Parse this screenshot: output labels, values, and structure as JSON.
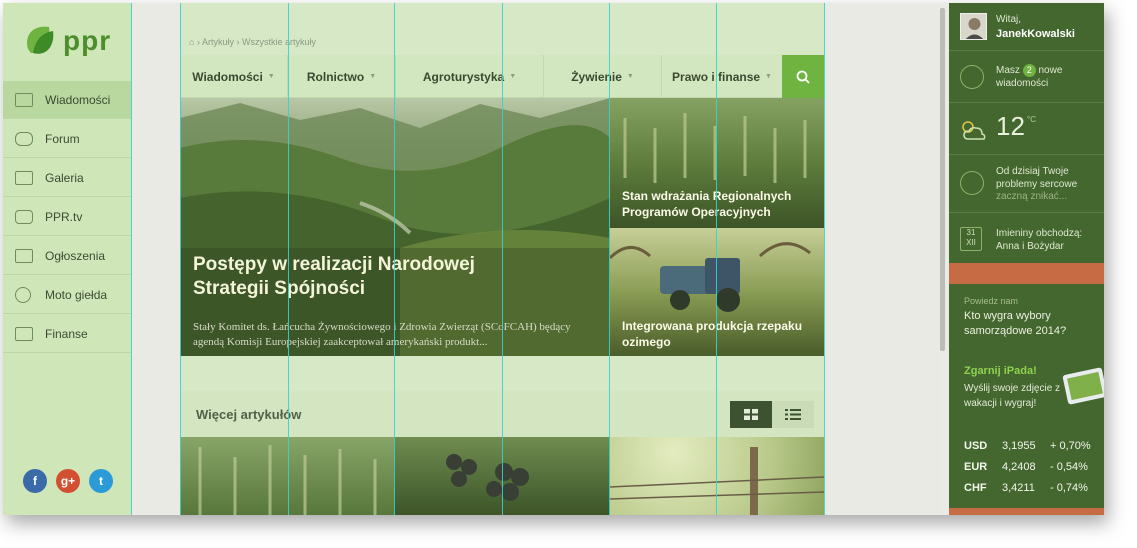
{
  "brand": {
    "logo_text": "ppr",
    "accent": "#6fb341",
    "orange": "#c76b45"
  },
  "sidebar": {
    "items": [
      {
        "label": "Wiadomości",
        "icon": "newspaper-icon",
        "active": true
      },
      {
        "label": "Forum",
        "icon": "chat-bubbles-icon"
      },
      {
        "label": "Galeria",
        "icon": "gallery-icon"
      },
      {
        "label": "PPR.tv",
        "icon": "play-icon"
      },
      {
        "label": "Ogłoszenia",
        "icon": "classifieds-icon"
      },
      {
        "label": "Moto giełda",
        "icon": "wheel-icon"
      },
      {
        "label": "Finanse",
        "icon": "finance-icon"
      }
    ],
    "social": [
      {
        "label": "f",
        "icon": "facebook-icon"
      },
      {
        "label": "g+",
        "icon": "googleplus-icon"
      },
      {
        "label": "t",
        "icon": "twitter-icon"
      }
    ]
  },
  "breadcrumb": {
    "home_icon": "home-icon",
    "sep": "›",
    "items": [
      "Artykuły",
      "Wszystkie artykuły"
    ]
  },
  "topnav": {
    "items": [
      "Wiadomości",
      "Rolnictwo",
      "Agroturystyka",
      "Żywienie",
      "Prawo i finanse"
    ],
    "search_icon": "search-icon"
  },
  "hero": {
    "title": "Postępy w realizacji Narodowej Strategii Spójności",
    "desc": "Stały Komitet ds. Łańcucha Żywnościowego i Zdrowia Zwierząt (SCoFCAH) będący agendą Komisji Europejskiej zaakceptował amerykański produkt..."
  },
  "side_articles": [
    {
      "title": "Stan wdrażania Regionalnych Programów Operacyjnych"
    },
    {
      "title": "Integrowana produkcja rzepaku ozimego"
    }
  ],
  "more": {
    "title": "Więcej artykułów",
    "grid_icon": "grid-view-icon",
    "list_icon": "list-view-icon"
  },
  "right": {
    "greeting": "Witaj,",
    "username": "JanekKowalski",
    "messages": {
      "prefix": "Masz",
      "count": "2",
      "suffix": "nowe wiadomości"
    },
    "weather": {
      "temp": "12",
      "unit": "°C",
      "icon": "sun-cloud-icon"
    },
    "horoscope": "Od dzisiaj Twoje problemy sercowe",
    "horoscope_more": "zaczną znikać...",
    "calendar": {
      "day": "31",
      "month": "XII"
    },
    "nameday_label": "Imieniny obchodzą:",
    "nameday_names": "Anna i Bożydar",
    "poll_label": "Powiedz nam",
    "poll_question": "Kto wygra wybory samorządowe 2014?",
    "promo_title": "Zgarnij iPada!",
    "promo_desc": "Wyślij swoje zdjęcie z wakacji i wygraj!",
    "currencies": [
      {
        "code": "USD",
        "rate": "3,1955",
        "change": "+ 0,70%"
      },
      {
        "code": "EUR",
        "rate": "4,2408",
        "change": "- 0,54%"
      },
      {
        "code": "CHF",
        "rate": "3,4211",
        "change": "- 0,74%"
      }
    ]
  }
}
